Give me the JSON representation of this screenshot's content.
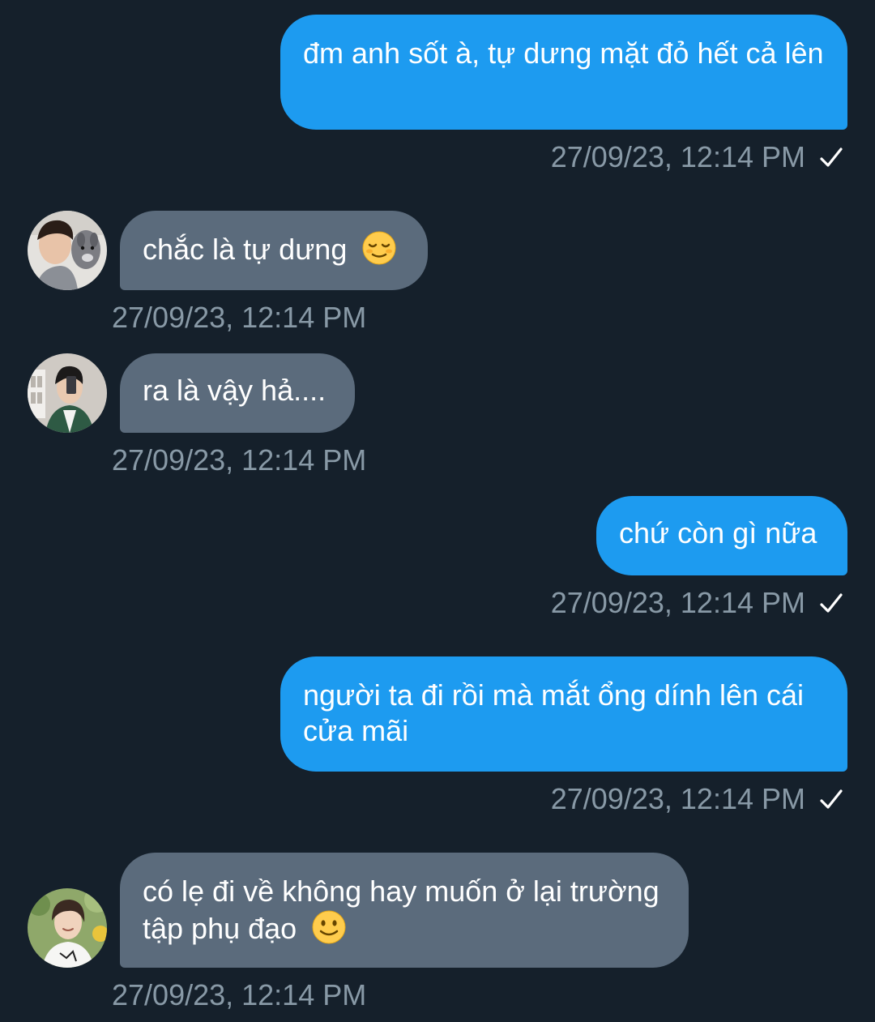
{
  "messages": [
    {
      "direction": "sent",
      "text": "đm anh sốt à, tự dưng mặt đỏ hết cả lên",
      "time": "27/09/23, 12:14 PM",
      "status": "read-check"
    },
    {
      "direction": "received",
      "text": "chắc là tự dưng",
      "emoji": "relieved-face",
      "time": "27/09/23, 12:14 PM"
    },
    {
      "direction": "received",
      "text": "ra là vậy hả....",
      "time": "27/09/23, 12:14 PM"
    },
    {
      "direction": "sent",
      "text": "chứ còn gì nữa",
      "time": "27/09/23, 12:14 PM",
      "status": "read-check"
    },
    {
      "direction": "sent",
      "text": "người ta đi rồi mà mắt ổng dính lên cái cửa mãi",
      "time": "27/09/23, 12:14 PM",
      "status": "read-check"
    },
    {
      "direction": "received",
      "text": "có lẹ đi về không hay muốn ở lại trường tập phụ đạo",
      "emoji": "slightly-smiling-face",
      "time": "27/09/23, 12:14 PM"
    }
  ],
  "colors": {
    "background": "#15202b",
    "sent_bubble": "#1d9bf0",
    "received_bubble": "#5b6b7c",
    "timestamp": "#8899a6"
  }
}
